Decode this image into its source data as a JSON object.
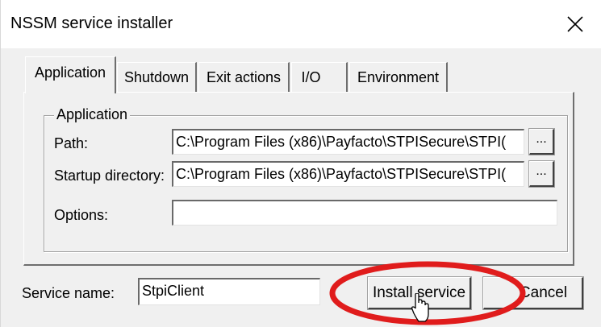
{
  "window": {
    "title": "NSSM service installer"
  },
  "tabs": [
    {
      "label": "Application",
      "active": true
    },
    {
      "label": "Shutdown",
      "active": false
    },
    {
      "label": "Exit actions",
      "active": false
    },
    {
      "label": "I/O",
      "active": false
    },
    {
      "label": "Environment",
      "active": false
    }
  ],
  "application": {
    "group_label": "Application",
    "path_label": "Path:",
    "path_value": "C:\\Program Files (x86)\\Payfacto\\STPISecure\\STPI(",
    "startup_label": "Startup directory:",
    "startup_value": "C:\\Program Files (x86)\\Payfacto\\STPISecure\\STPI(",
    "options_label": "Options:",
    "options_value": "",
    "browse_label": "..."
  },
  "footer": {
    "service_name_label": "Service name:",
    "service_name_value": "StpiClient",
    "install_label": "Install service",
    "cancel_label": "Cancel"
  },
  "icons": [
    "close-icon",
    "pointer-cursor-icon"
  ],
  "colors": {
    "annotation_circle": "#e01c1c",
    "dialog_bg": "#f0f0f0"
  }
}
